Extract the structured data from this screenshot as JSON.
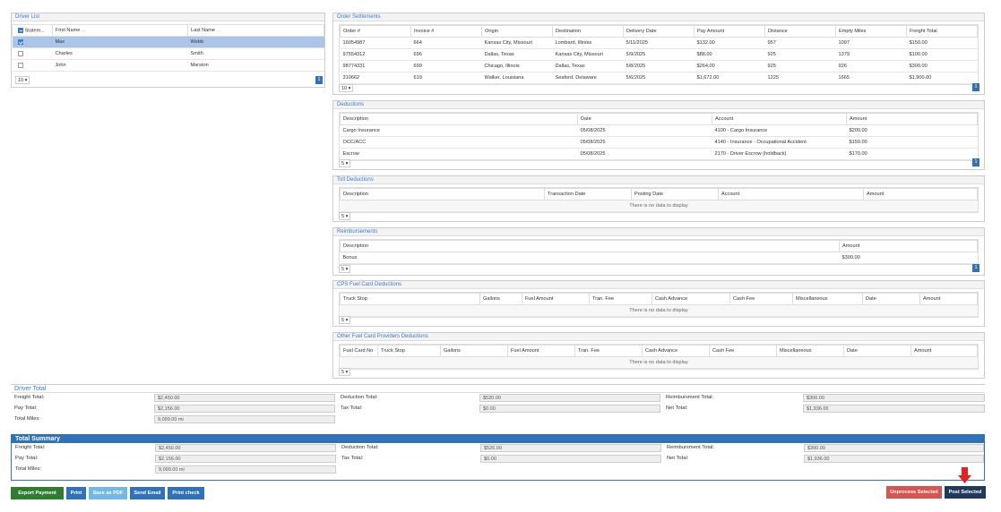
{
  "driver_list": {
    "title": "Driver List",
    "columns": [
      "Statem...",
      "First Name",
      "Last Name"
    ],
    "rows": [
      {
        "first": "Max",
        "last": "Webb",
        "checked": true
      },
      {
        "first": "Charles",
        "last": "Smith",
        "checked": false
      },
      {
        "first": "John",
        "last": "Marston",
        "checked": false
      }
    ],
    "pager": "10",
    "page": "1"
  },
  "orders": {
    "title": "Order Settlements",
    "columns": [
      "Order #",
      "Invoice #",
      "Origin",
      "Destination",
      "Delivery Date",
      "Pay Amount",
      "Distance",
      "Empty Miles",
      "Freight Total"
    ],
    "rows": [
      [
        "16054987",
        "664",
        "Kansas City, Missouri",
        "Lombard, Illinois",
        "5/11/2025",
        "$132.00",
        "957",
        "1097",
        "$150.00"
      ],
      [
        "97554312",
        "696",
        "Dallas, Texas",
        "Kansas City, Missouri",
        "5/9/2025",
        "$88.00",
        "925",
        "1379",
        "$100.00"
      ],
      [
        "98774331",
        "699",
        "Chicago, Illinois",
        "Dallas, Texas",
        "5/8/2025",
        "$264.00",
        "925",
        "926",
        "$300.00"
      ],
      [
        "310662",
        "619",
        "Walker, Louisiana",
        "Seaford, Delaware",
        "5/6/2025",
        "$1,672.00",
        "1225",
        "1665",
        "$1,900.00"
      ]
    ],
    "pager": "10",
    "page": "1"
  },
  "deductions": {
    "title": "Deductions",
    "columns": [
      "Description",
      "Date",
      "Account",
      "Amount"
    ],
    "rows": [
      [
        "Cargo Insurance",
        "05/08/2025",
        "4100 - Cargo Insurance",
        "$200.00"
      ],
      [
        "OCC/ACC",
        "05/08/2025",
        "4140 - Insurance - Occupational Accident",
        "$150.00"
      ],
      [
        "Escrow",
        "05/08/2025",
        "2170 - Driver Escrow (holdback)",
        "$170.00"
      ]
    ],
    "pager": "5",
    "page": "1"
  },
  "toll": {
    "title": "Toll Deductions",
    "columns": [
      "Description",
      "Transaction Date",
      "Posting Date",
      "Account",
      "Amount"
    ],
    "empty": "There is no data to display",
    "pager": "5"
  },
  "reimb": {
    "title": "Reimbursements",
    "columns": [
      "Description",
      "Amount"
    ],
    "rows": [
      [
        "Bonus",
        "$300.00"
      ]
    ],
    "pager": "5",
    "page": "1"
  },
  "cps": {
    "title": "CPS Fuel Card Deductions",
    "columns": [
      "Truck Stop",
      "Gallons",
      "Fuel Amount",
      "Tran. Fee",
      "Cash Advance",
      "Cash Fee",
      "Miscellaneous",
      "Date",
      "Amount"
    ],
    "empty": "There is no data to display",
    "pager": "5"
  },
  "other": {
    "title": "Other Fuel Card Providers Deductions",
    "columns": [
      "Fuel Card No",
      "Truck Stop",
      "Gallons",
      "Fuel Amount",
      "Tran. Fee",
      "Cash Advance",
      "Cash Fee",
      "Miscellaneous",
      "Date",
      "Amount"
    ],
    "empty": "There is no data to display",
    "pager": "5"
  },
  "driver_total": {
    "title": "Driver Total",
    "freight_label": "Freight Total:",
    "freight": "$2,450.00",
    "pay_label": "Pay Total:",
    "pay": "$2,156.00",
    "miles_label": "Total Miles:",
    "miles": "9,099.00 mi",
    "ded_label": "Deduction Total:",
    "ded": "$520.00",
    "tax_label": "Tax Total:",
    "tax": "$0.00",
    "reimb_label": "Reimbursment Total:",
    "reimb": "$300.00",
    "net_label": "Net Total:",
    "net": "$1,936.00"
  },
  "total_summary": {
    "title": "Total Summary",
    "freight_label": "Freight Total:",
    "freight": "$2,450.00",
    "pay_label": "Pay Total:",
    "pay": "$2,156.00",
    "miles_label": "Total Miles:",
    "miles": "9,099.00 mi",
    "ded_label": "Deduction Total:",
    "ded": "$520.00",
    "tax_label": "Tax Total:",
    "tax": "$0.00",
    "reimb_label": "Reimbursment Total:",
    "reimb": "$300.00",
    "net_label": "Net Total:",
    "net": "$1,936.00"
  },
  "buttons": {
    "export": "Export Payment List",
    "print": "Print",
    "pdf": "Save as PDF",
    "email": "Send Email",
    "printcheck": "Print check",
    "unprocess": "Unprocess Selected",
    "post": "Post Selected"
  },
  "colors": {
    "accent": "#2f72b7",
    "export": "#2e7d32",
    "danger": "#d9534f",
    "dark": "#1f3a5a",
    "arrow": "#e32222"
  }
}
